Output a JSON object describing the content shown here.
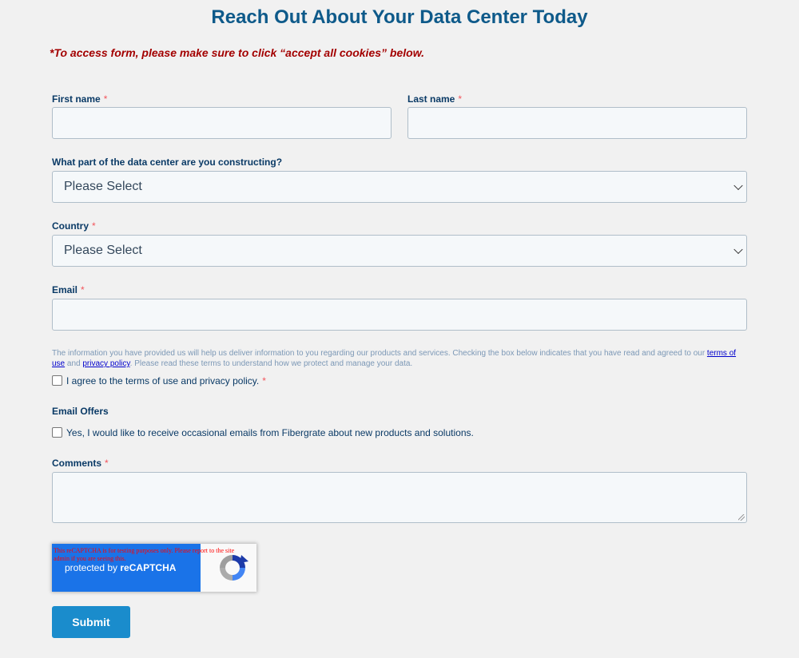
{
  "page": {
    "title": "Reach Out About Your Data Center Today",
    "cookie_note": "*To access form, please make sure to click “accept all cookies” below."
  },
  "form": {
    "required_mark": "*",
    "first_name": {
      "label": "First name",
      "value": ""
    },
    "last_name": {
      "label": "Last name",
      "value": ""
    },
    "data_center_part": {
      "label": "What part of the data center are you constructing?",
      "selected": "Please Select"
    },
    "country": {
      "label": "Country",
      "selected": "Please Select"
    },
    "email": {
      "label": "Email",
      "value": ""
    },
    "legal": {
      "text_1": "The information you have provided us will help us deliver information to you regarding our products and services. Checking the box below indicates that you have read and agreed to our ",
      "terms_link": "terms of use",
      "and": " and ",
      "privacy_link": "privacy policy",
      "text_2": ". Please read these terms to understand how we protect and manage your data."
    },
    "agree_checkbox": {
      "label": "I agree to the terms of use and privacy policy.",
      "checked": false
    },
    "email_offers": {
      "heading": "Email Offers",
      "checkbox_label": "Yes, I would like to receive occasional emails from Fibergrate about new products and solutions.",
      "checked": false
    },
    "comments": {
      "label": "Comments",
      "value": ""
    },
    "recaptcha": {
      "warning": "This reCAPTCHA is for testing purposes only. Please report to the site admin if you are seeing this.",
      "protected_by": "protected by",
      "brand": "reCAPTCHA"
    },
    "submit_label": "Submit"
  },
  "colors": {
    "title": "#0e5a8a",
    "cookie_note": "#a30000",
    "required": "#f2545b",
    "submit": "#1a8ccc",
    "recaptcha_blue": "#1a73e8"
  }
}
